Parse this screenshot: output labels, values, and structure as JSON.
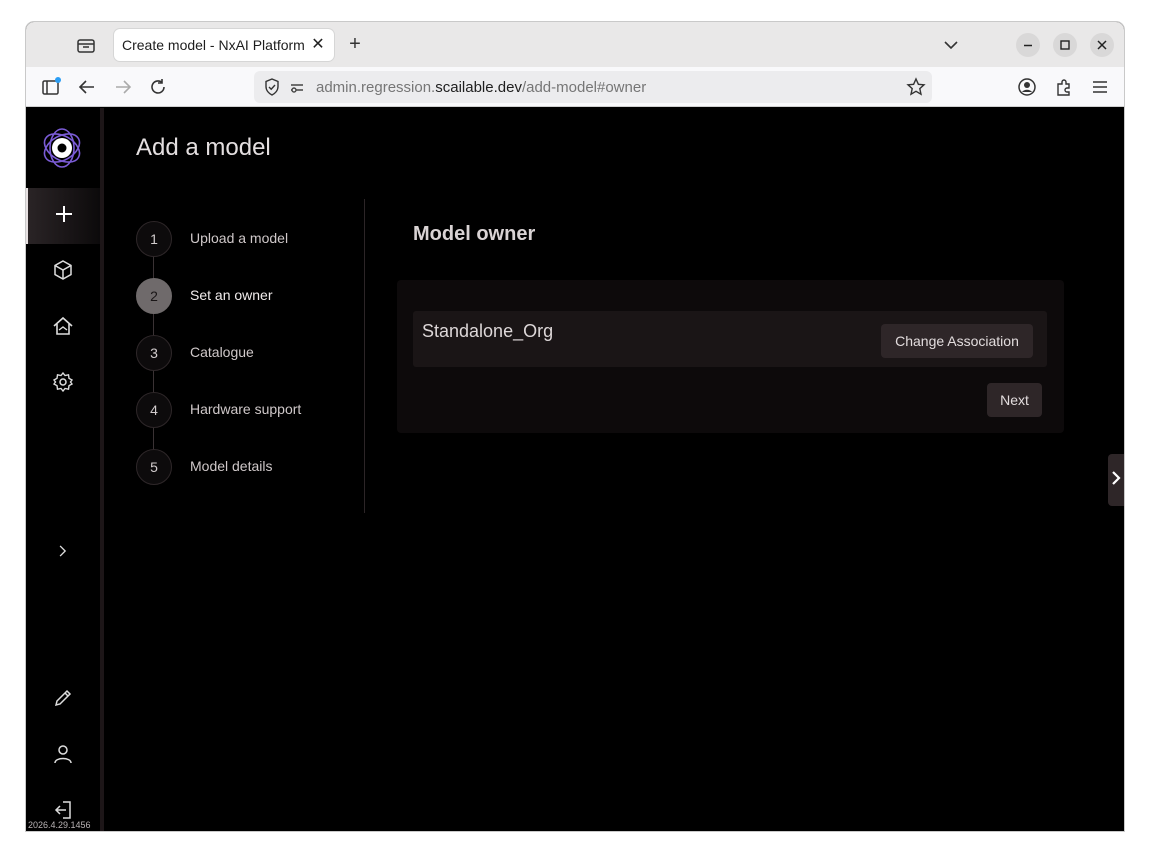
{
  "browser": {
    "tab_title": "Create model - NxAI Platform",
    "tab_close": "✕",
    "new_tab": "+",
    "url_host_prefix": "admin.regression.",
    "url_host": "scailable.dev",
    "url_path": "/add-model#owner"
  },
  "sidebar": {
    "items": [
      {
        "icon": "plus-icon",
        "active": true
      },
      {
        "icon": "cube-icon",
        "active": false
      },
      {
        "icon": "home-icon",
        "active": false
      },
      {
        "icon": "gear-icon",
        "active": false
      }
    ],
    "expand_icon": "chevron-right-icon",
    "bottom": [
      "pencil-icon",
      "user-icon",
      "logout-icon"
    ],
    "version": "2026.4.29.1456"
  },
  "page": {
    "title": "Add a model"
  },
  "stepper": {
    "current": 2,
    "steps": [
      {
        "number": "1",
        "label": "Upload a model"
      },
      {
        "number": "2",
        "label": "Set an owner"
      },
      {
        "number": "3",
        "label": "Catalogue"
      },
      {
        "number": "4",
        "label": "Hardware support"
      },
      {
        "number": "5",
        "label": "Model details"
      }
    ]
  },
  "owner": {
    "section_title": "Model owner",
    "org_name": "Standalone_Org",
    "change_label": "Change Association",
    "next_label": "Next"
  },
  "colors": {
    "background": "#000000",
    "card": "#0d0a0b",
    "button": "#2e2628",
    "accent_logo": "#7b5cd6"
  }
}
